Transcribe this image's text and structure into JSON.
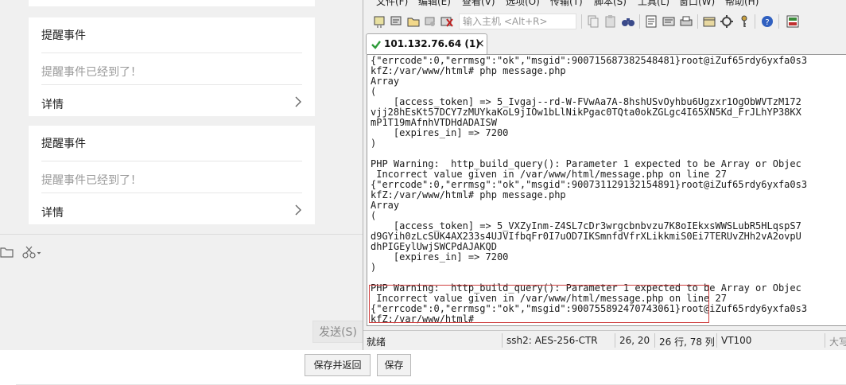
{
  "chat": {
    "cards": [
      {
        "title": "提醒事件",
        "description": "提醒事件已经到了！",
        "detail_label": "详情"
      },
      {
        "title": "提醒事件",
        "description": "提醒事件已经到了！",
        "detail_label": "详情"
      }
    ],
    "send_label": "发送(S)"
  },
  "terminal_window": {
    "menu": [
      "文件(F)",
      "编辑(E)",
      "查看(V)",
      "选项(O)",
      "传输(T)",
      "脚本(S)",
      "工具(L)",
      "窗口(W)",
      "帮助(H)"
    ],
    "quick_connect_placeholder": "输入主机 <Alt+R>",
    "tab": {
      "label": "101.132.76.64 (1)",
      "close": "×"
    },
    "lines": [
      "{\"errcode\":0,\"errmsg\":\"ok\",\"msgid\":900715687382548481}root@iZuf65rdy6yxfa0s3",
      "kfZ:/var/www/html# php message.php",
      "Array",
      "(",
      "    [access_token] => 5_Ivgaj--rd-W-FVwAa7A-8hshUSvOyhbu6Ugzxr1OgObWVTzM172",
      "vjj28hEsKt57DCY7zMUYkaKoL9jIOw1bLlNikPgac0TQta0okZGLgc4I65XN5Kd_FrJLhYP38KX",
      "mP1T19mAfnhVTDHdADAISW",
      "    [expires_in] => 7200",
      ")",
      "",
      "PHP Warning:  http_build_query(): Parameter 1 expected to be Array or Objec",
      " Incorrect value given in /var/www/html/message.php on line 27",
      "{\"errcode\":0,\"errmsg\":\"ok\",\"msgid\":900731129132154891}root@iZuf65rdy6yxfa0s3",
      "kfZ:/var/www/html# php message.php",
      "Array",
      "(",
      "    [access_token] => 5_VXZyInm-Z4SL7cDr3wrgcbnbvzu7K8oIEkxsWWSLubR5HLqspS7",
      "d9GYih0zLcSUK4AX233s4UJVIfbqFr0I7uOD7IKSmnfdVfrXLikkmiS0Ei7TERUvZHh2vA2ovpU",
      "dhPIGEylUwjSWCPdAJAKQD",
      "    [expires_in] => 7200",
      ")",
      "",
      "PHP Warning:  http_build_query(): Parameter 1 expected to be Array or Objec",
      " Incorrect value given in /var/www/html/message.php on line 27",
      "{\"errcode\":0,\"errmsg\":\"ok\",\"msgid\":900755892470743061}root@iZuf65rdy6yxfa0s3",
      "kfZ:/var/www/html# "
    ],
    "status": {
      "ready": "就绪",
      "protocol": "ssh2: AES-256-CTR",
      "cursor": "26,  20",
      "size": "26 行, 78 列",
      "terminal_type": "VT100",
      "caps": "大写"
    }
  },
  "form": {
    "save_return_label": "保存并返回",
    "save_label": "保存"
  },
  "colors": {
    "panel_bg": "#f0f0f0",
    "highlight_border": "#d04040",
    "tab_check": "#2e9b3a"
  },
  "icons": [
    "folder-icon",
    "scissors-icon",
    "chevron-right-icon",
    "checkmark-icon",
    "close-icon"
  ]
}
